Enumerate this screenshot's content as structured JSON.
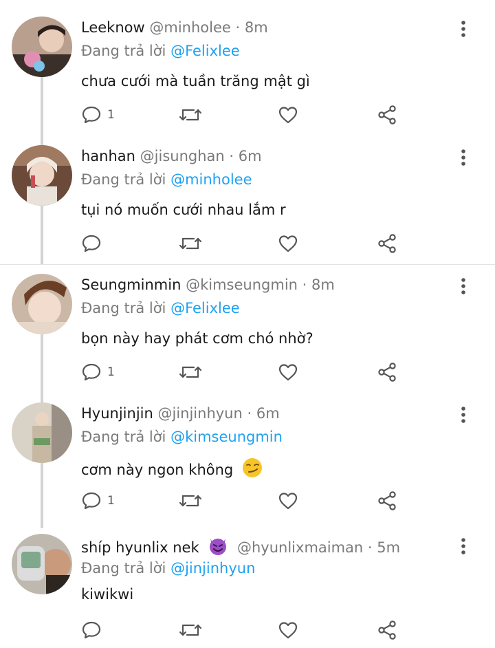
{
  "reply_prefix": "Đang trả lời",
  "tweets": [
    {
      "name": "Leeknow",
      "handle": "@minholee",
      "separator": "·",
      "time": "8m",
      "reply_to": "@Felixlee",
      "text": "chưa cưới mà tuần trăng mật gì",
      "reply_count": "1"
    },
    {
      "name": "hanhan",
      "handle": "@jisunghan",
      "separator": "·",
      "time": "6m",
      "reply_to": "@minholee",
      "text": "tụi nó muốn cưới nhau lắm r",
      "reply_count": ""
    },
    {
      "name": "Seungminmin",
      "handle": "@kimseungmin",
      "separator": "·",
      "time": "8m",
      "reply_to": "@Felixlee",
      "text": "bọn này hay phát cơm chó nhờ?",
      "reply_count": "1"
    },
    {
      "name": "Hyunjinjin",
      "handle": "@jinjinhyun",
      "separator": "·",
      "time": "6m",
      "reply_to": "@kimseungmin",
      "text": "cơm này ngon không",
      "text_emoji": "smirking-face",
      "reply_count": "1"
    },
    {
      "name": "shíp hyunlix nek",
      "name_emoji": "smiling-face-with-horns",
      "handle": "@hyunlixmaiman",
      "separator": "·",
      "time": "5m",
      "reply_to": "@jinjinhyun",
      "text": "kiwikwi",
      "reply_count": ""
    }
  ],
  "icons": [
    "reply-icon",
    "retweet-icon",
    "like-icon",
    "share-icon",
    "more-options-icon"
  ],
  "colors": {
    "mention": "#1da1f2",
    "secondary_text": "#7a7a7a",
    "thread_line": "#d3d3d3"
  }
}
